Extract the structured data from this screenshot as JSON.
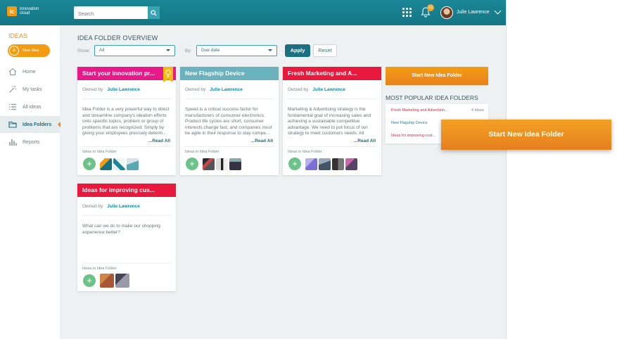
{
  "app": {
    "logo_text": "innovation cloud",
    "logo_mark": "ic",
    "search_placeholder": "Search",
    "notification_count": "13",
    "user_name": "Julie Lawrence"
  },
  "sidebar": {
    "title": "IDEAS",
    "new_idea_label": "New Idea",
    "items": [
      {
        "label": "Home",
        "icon": "home-icon"
      },
      {
        "label": "My tasks",
        "icon": "magic-wand-icon"
      },
      {
        "label": "All ideas",
        "icon": "list-icon"
      },
      {
        "label": "Idea Folders",
        "icon": "folder-icon"
      },
      {
        "label": "Reports",
        "icon": "bar-chart-icon"
      }
    ]
  },
  "toolbar": {
    "page_title": "IDEA FOLDER OVERVIEW",
    "show_label": "Show:",
    "show_value": "All",
    "by_label": "By:",
    "by_value": "Due date",
    "apply_label": "Apply",
    "reset_label": "Reset"
  },
  "cards": [
    {
      "title": "Start your innovation pr...",
      "color": "#e8178a",
      "owned_label": "Owned by",
      "owner": "Julie Lawrence",
      "description": "Idea Folder is a very powerful way to direct and streamline company's ideation efforts onto specific topics, problem or group of problems that are recognized. Simply by giving your employees precisely determ...",
      "read_all": "...Read All",
      "ideas_label": "Ideas in Idea Folder"
    },
    {
      "title": "New Flagship Device",
      "color": "#6ab2bd",
      "owned_label": "Owned by",
      "owner": "Julie Lawrence",
      "description": "Speed is a critical success factor for manufacturers of consumer electronics. Product life cycles are short, consumer interests change fast, and companies must be agile in their response to stay compe...",
      "read_all": "...Read All",
      "ideas_label": "Ideas in Idea Folder"
    },
    {
      "title": "Fresh Marketing and A...",
      "color": "#e8193c",
      "owned_label": "Owned by",
      "owner": "Julie Lawrence",
      "description": "Marketing & Advertising strategy is the fundamental goal of increasing sales and achieving a sustainable competitive advantage. We need to put focus of our strategy to meet customers needs. All ideas...",
      "read_all": "...Read All",
      "ideas_label": "Ideas in Idea Folder"
    },
    {
      "title": "Ideas for improving cus...",
      "color": "#e8193c",
      "owned_label": "Owned by",
      "owner": "Julie Lawrence",
      "description": "What can we do to make our shopping experience better?",
      "read_all": "",
      "ideas_label": "Ideas in Idea Folder"
    }
  ],
  "right_panel": {
    "start_button": "Start New Idea Folder",
    "popular_title": "MOST POPULAR IDEA FOLDERS",
    "popular": [
      {
        "name": "Fresh Marketing and Advertizin...",
        "count": "4 Ideas",
        "color": "#e8193c"
      },
      {
        "name": "New Flagship Device",
        "count": "",
        "color": "#1a8797"
      },
      {
        "name": "Ideas for improving cust...",
        "count": "",
        "color": "#e8193c"
      }
    ]
  },
  "overlay_button": "Start New Idea Folder"
}
